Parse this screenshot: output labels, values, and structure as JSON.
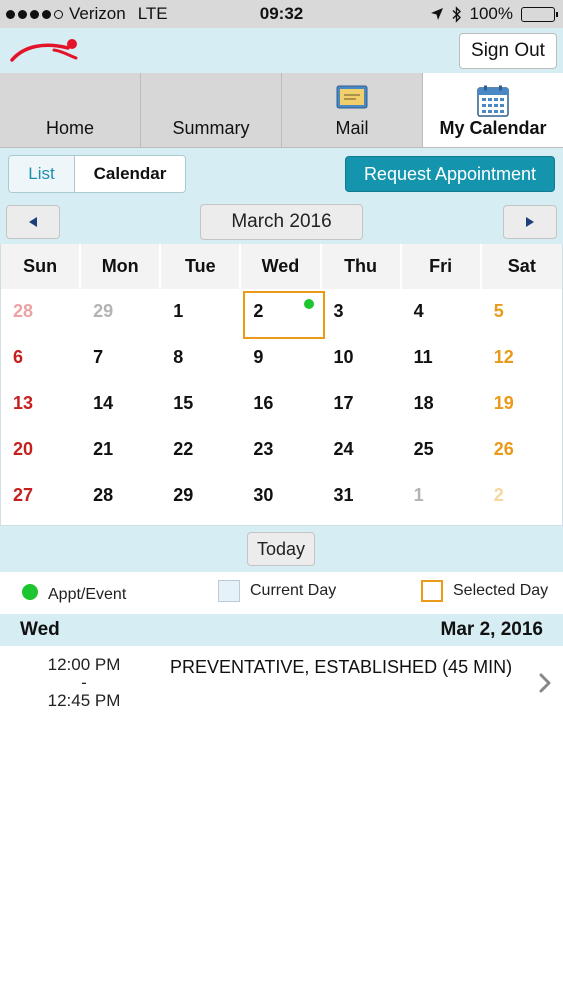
{
  "status_bar": {
    "carrier": "Verizon",
    "network": "LTE",
    "time": "09:32",
    "battery": "100%"
  },
  "header": {
    "sign_out": "Sign Out",
    "logo_color": "#e3142a"
  },
  "tabs": [
    {
      "label": "Home",
      "active": false
    },
    {
      "label": "Summary",
      "active": false
    },
    {
      "label": "Mail",
      "active": false
    },
    {
      "label": "My Calendar",
      "active": true
    }
  ],
  "view_toggle": {
    "list": "List",
    "calendar": "Calendar",
    "selected": "Calendar"
  },
  "request_button": "Request Appointment",
  "calendar": {
    "month_label": "March 2016",
    "weekdays": [
      "Sun",
      "Mon",
      "Tue",
      "Wed",
      "Thu",
      "Fri",
      "Sat"
    ],
    "weeks": [
      [
        "28",
        "29",
        "1",
        "2",
        "3",
        "4",
        "5"
      ],
      [
        "6",
        "7",
        "8",
        "9",
        "10",
        "11",
        "12"
      ],
      [
        "13",
        "14",
        "15",
        "16",
        "17",
        "18",
        "19"
      ],
      [
        "20",
        "21",
        "22",
        "23",
        "24",
        "25",
        "26"
      ],
      [
        "27",
        "28",
        "29",
        "30",
        "31",
        "1",
        "2"
      ]
    ],
    "selected_day": "2",
    "event_days": [
      "2"
    ],
    "colors": {
      "sunday": "#c51f1f",
      "saturday": "#e89a18",
      "selected_border": "#e89a18",
      "event_dot": "#1dc52e"
    }
  },
  "today_button": "Today",
  "legend": {
    "appt": "Appt/Event",
    "current": "Current Day",
    "selected": "Selected Day"
  },
  "day_header": {
    "weekday": "Wed",
    "date": "Mar 2, 2016"
  },
  "appointments": [
    {
      "start": "12:00 PM",
      "separator": "-",
      "end": "12:45 PM",
      "title": "PREVENTATIVE, ESTABLISHED (45 MIN)"
    }
  ],
  "accent_color": "#1594ae"
}
